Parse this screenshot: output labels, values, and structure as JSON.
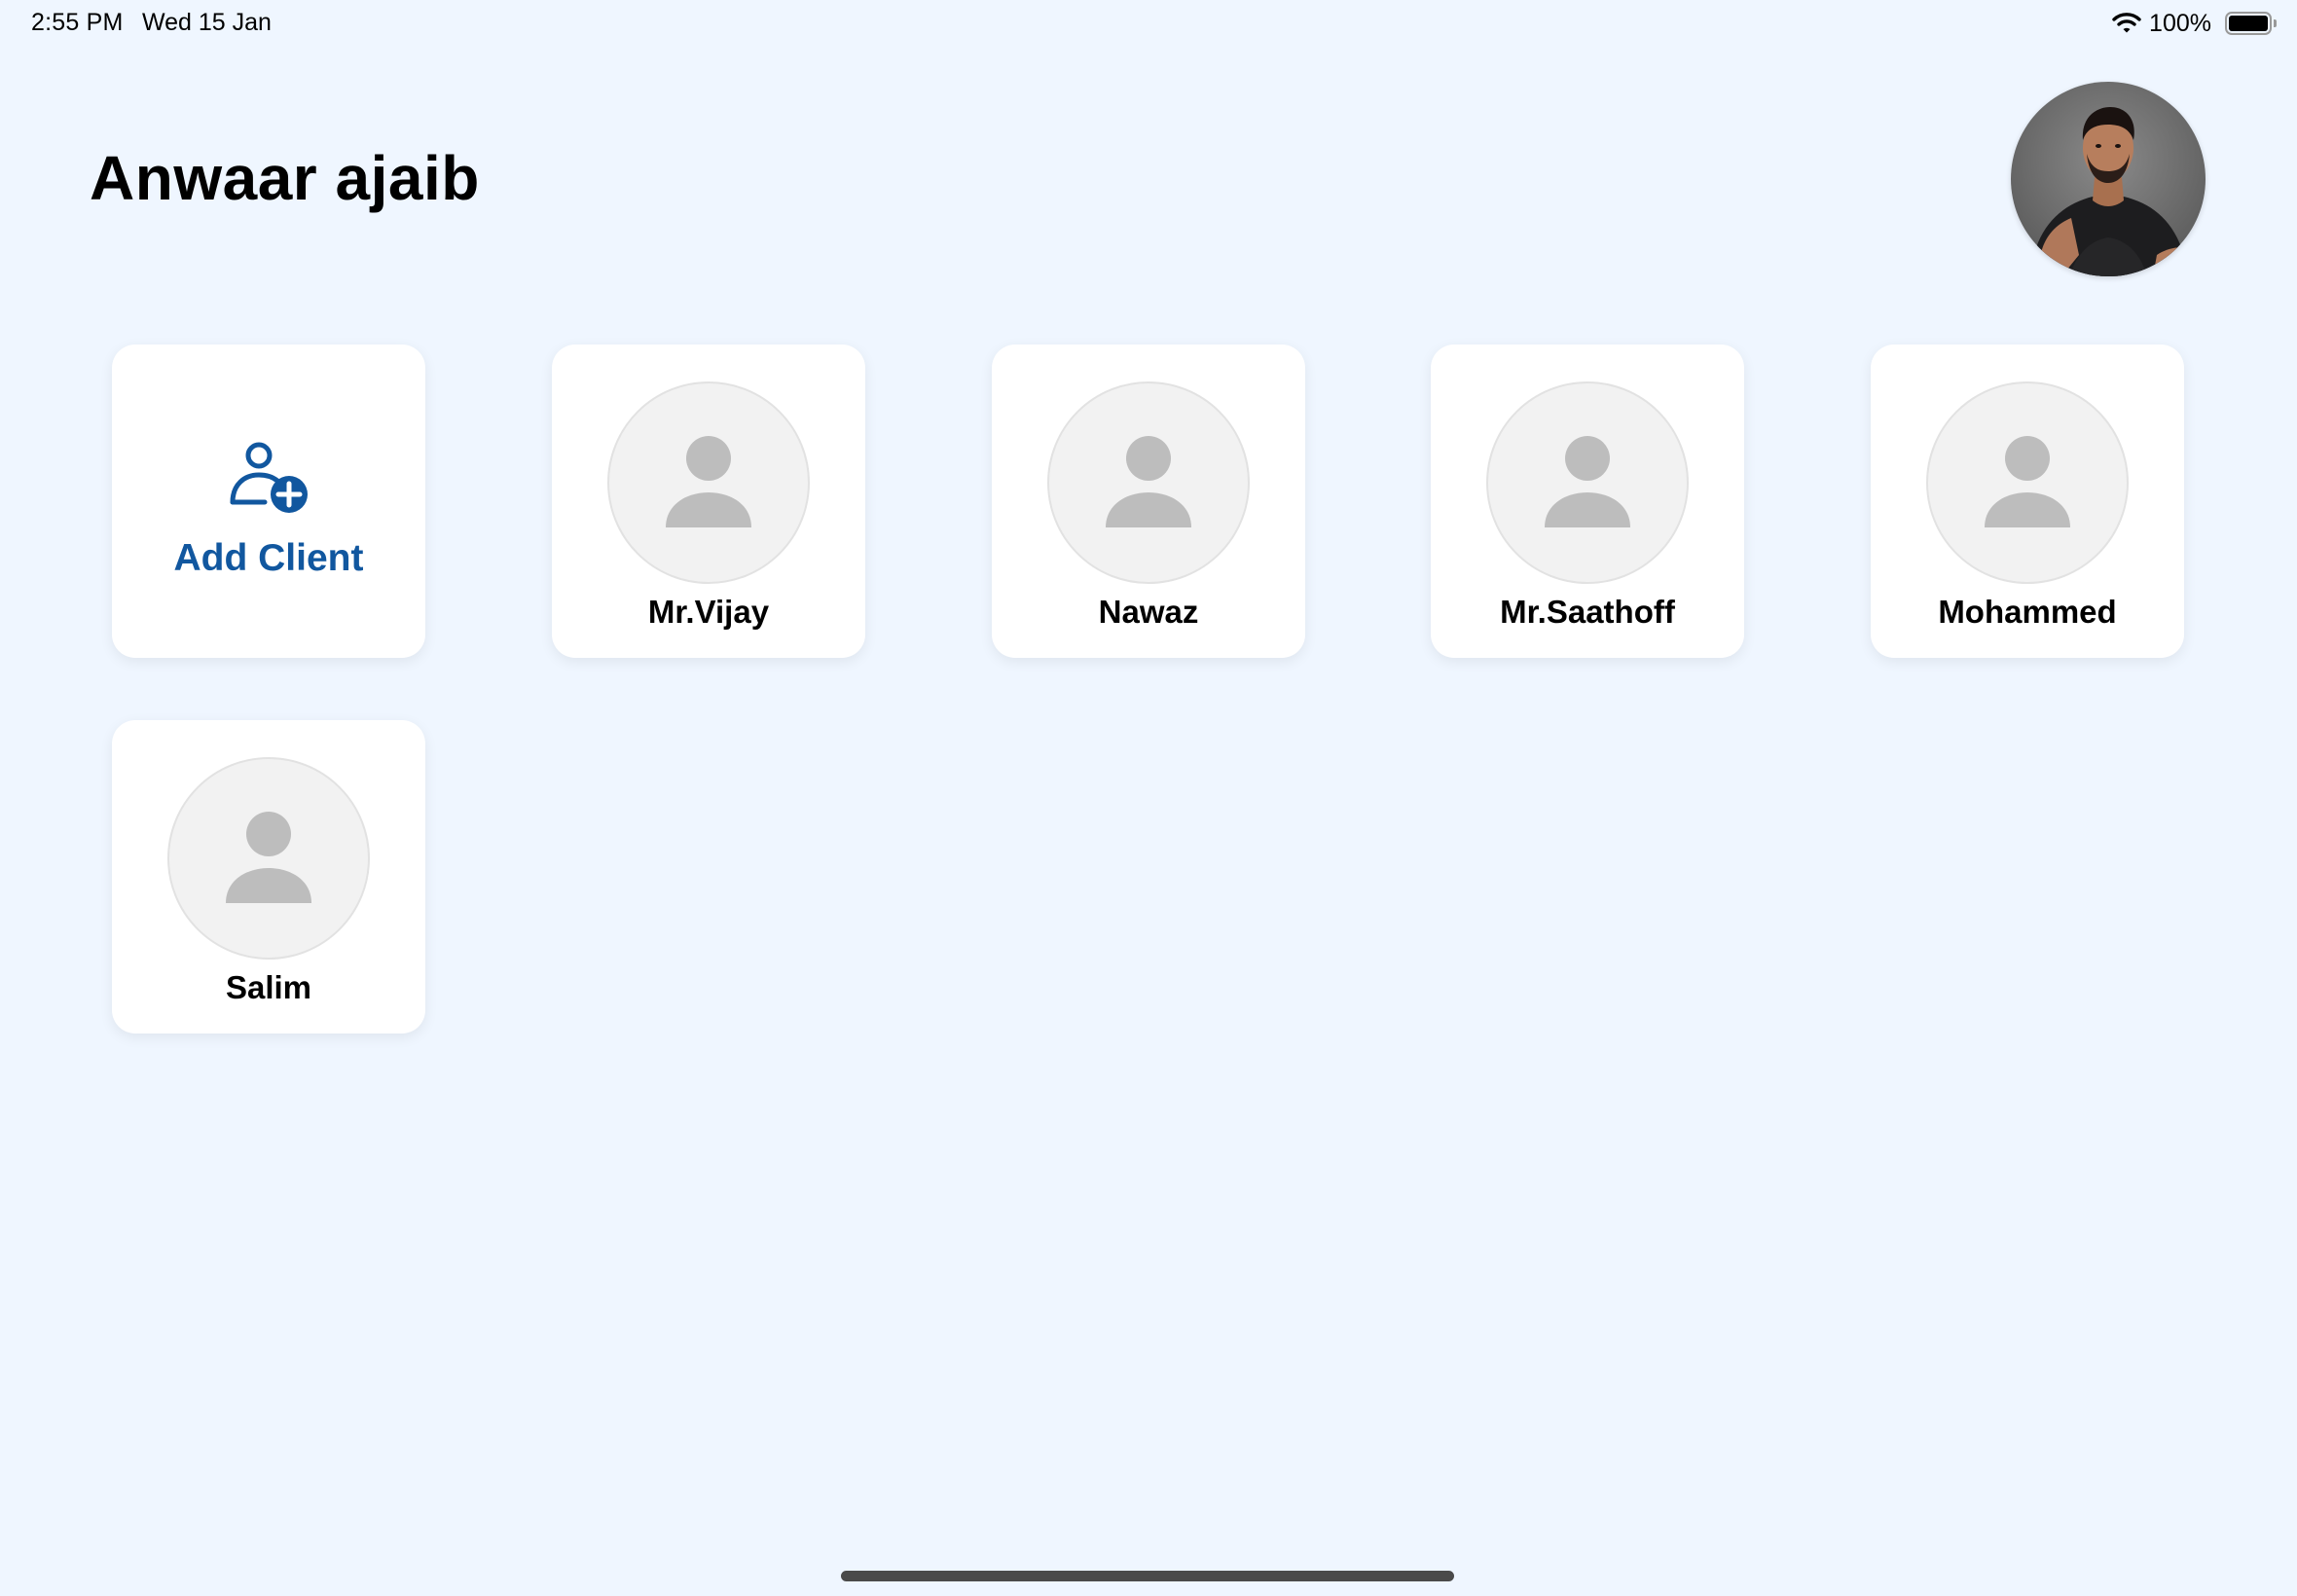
{
  "status_bar": {
    "time": "2:55 PM",
    "date": "Wed 15 Jan",
    "battery_percent": "100%",
    "battery_level": 1.0,
    "icons": [
      "wifi-icon",
      "battery-icon"
    ]
  },
  "header": {
    "title": "Anwaar ajaib",
    "profile_avatar_icon": "profile-photo"
  },
  "add_client": {
    "label": "Add Client",
    "icon": "person-add-icon",
    "accent_color": "#11579f"
  },
  "clients": [
    {
      "name": "Mr.Vijay"
    },
    {
      "name": "Nawaz"
    },
    {
      "name": "Mr.Saathoff"
    },
    {
      "name": "Mohammed"
    },
    {
      "name": "Salim"
    }
  ],
  "colors": {
    "background": "#eff6ff",
    "card": "#ffffff",
    "placeholder_avatar": "#bdbdbd"
  }
}
